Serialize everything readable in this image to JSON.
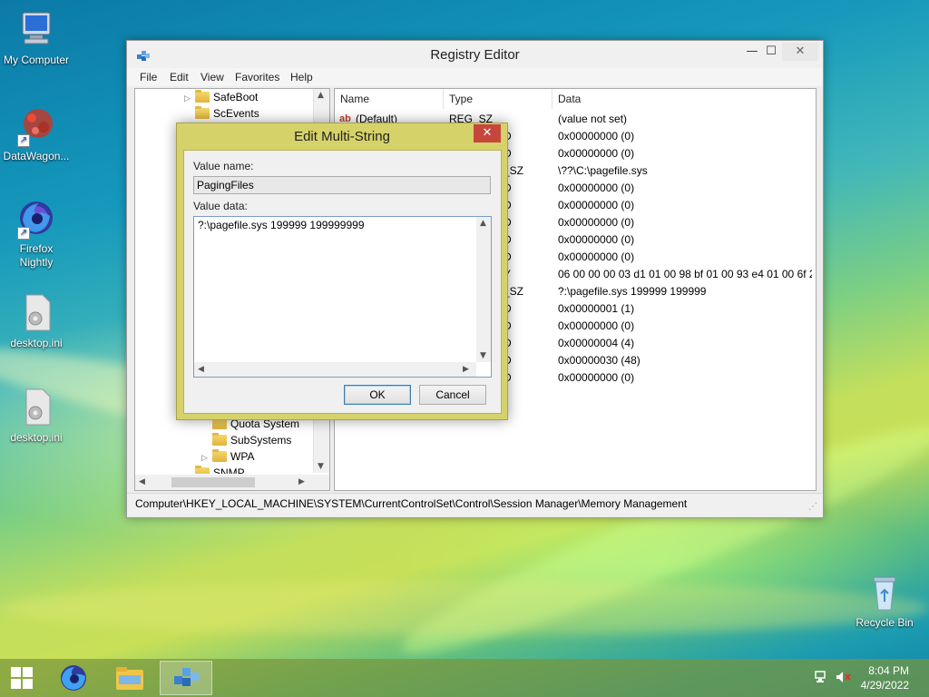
{
  "desktop": {
    "icons": [
      {
        "label": "My Computer",
        "icon": "computer-icon"
      },
      {
        "label": "DataWagon...",
        "icon": "datawagon-icon"
      },
      {
        "label": "Firefox Nightly",
        "icon": "firefox-nightly-icon"
      },
      {
        "label": "desktop.ini",
        "icon": "settings-file-icon"
      },
      {
        "label": "desktop.ini",
        "icon": "settings-file-icon"
      },
      {
        "label": "Recycle Bin",
        "icon": "recycle-bin-icon"
      }
    ]
  },
  "registry_editor": {
    "title": "Registry Editor",
    "controls": {
      "minimize": "—",
      "maximize": "☐",
      "close": "✕"
    },
    "menu": [
      "File",
      "Edit",
      "View",
      "Favorites",
      "Help"
    ],
    "tree": {
      "items": [
        {
          "label": "SafeBoot",
          "expander": "▷"
        },
        {
          "label": "ScEvents",
          "expander": ""
        },
        {
          "label": "Quota System",
          "expander": ""
        },
        {
          "label": "SubSystems",
          "expander": ""
        },
        {
          "label": "WPA",
          "expander": "▷"
        },
        {
          "label": "SNMP",
          "expander": ""
        }
      ]
    },
    "list": {
      "columns": [
        "Name",
        "Type",
        "Data"
      ],
      "rows": [
        {
          "name": "(Default)",
          "type": "REG_SZ",
          "data": "(value not set)"
        },
        {
          "name": "",
          "type": "D",
          "data": "0x00000000 (0)"
        },
        {
          "name": "",
          "type": "D",
          "data": "0x00000000 (0)"
        },
        {
          "name": "",
          "type": "_SZ",
          "data": "\\??\\C:\\pagefile.sys"
        },
        {
          "name": "",
          "type": "D",
          "data": "0x00000000 (0)"
        },
        {
          "name": "",
          "type": "D",
          "data": "0x00000000 (0)"
        },
        {
          "name": "",
          "type": "D",
          "data": "0x00000000 (0)"
        },
        {
          "name": "",
          "type": "D",
          "data": "0x00000000 (0)"
        },
        {
          "name": "",
          "type": "D",
          "data": "0x00000000 (0)"
        },
        {
          "name": "",
          "type": "Y",
          "data": "06 00 00 00 03 d1 01 00 98 bf 01 00 93 e4 01 00 6f 24..."
        },
        {
          "name": "",
          "type": "_SZ",
          "data": "?:\\pagefile.sys 199999 199999"
        },
        {
          "name": "",
          "type": "D",
          "data": "0x00000001 (1)"
        },
        {
          "name": "",
          "type": "D",
          "data": "0x00000000 (0)"
        },
        {
          "name": "",
          "type": "D",
          "data": "0x00000004 (4)"
        },
        {
          "name": "",
          "type": "D",
          "data": "0x00000030 (48)"
        },
        {
          "name": "",
          "type": "D",
          "data": "0x00000000 (0)"
        }
      ]
    },
    "status": "Computer\\HKEY_LOCAL_MACHINE\\SYSTEM\\CurrentControlSet\\Control\\Session Manager\\Memory Management"
  },
  "dialog": {
    "title": "Edit Multi-String",
    "close": "✕",
    "value_name_label": "Value name:",
    "value_name": "PagingFiles",
    "value_data_label": "Value data:",
    "value_data": "?:\\pagefile.sys 199999 199999999",
    "ok": "OK",
    "cancel": "Cancel"
  },
  "taskbar": {
    "buttons": [
      "start-icon",
      "firefox-nightly-icon",
      "file-explorer-icon",
      "registry-editor-icon"
    ],
    "tray": {
      "network": "network-icon",
      "volume": "volume-muted-icon"
    },
    "time": "8:04 PM",
    "date": "4/29/2022"
  }
}
